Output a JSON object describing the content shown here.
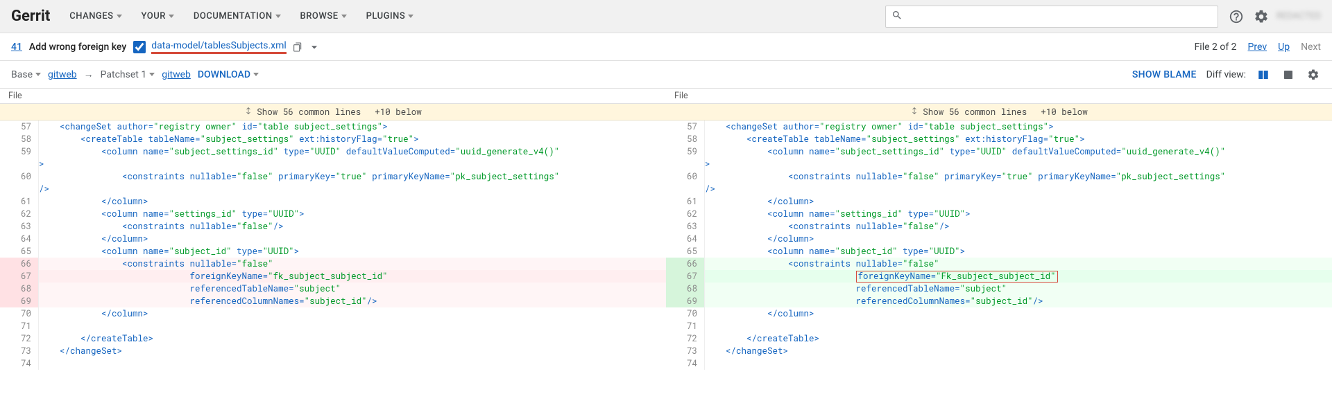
{
  "nav": {
    "brand": "Gerrit",
    "items": [
      "CHANGES",
      "YOUR",
      "DOCUMENTATION",
      "BROWSE",
      "PLUGINS"
    ],
    "search_placeholder": "",
    "user": "REDACTED"
  },
  "subheader": {
    "cl_number": "41",
    "title": "Add wrong foreign key",
    "reviewed": true,
    "filepath": "data-model/tablesSubjects.xml",
    "file_pos": "File 2 of 2",
    "prev": "Prev",
    "up": "Up",
    "next": "Next"
  },
  "patchbar": {
    "base": "Base",
    "gitweb1": "gitweb",
    "arrow": "→",
    "patchset": "Patchset 1",
    "gitweb2": "gitweb",
    "download": "DOWNLOAD",
    "show_blame": "SHOW BLAME",
    "diffview_label": "Diff view:"
  },
  "filehdr": {
    "left": "File",
    "right": "File"
  },
  "commonbanner": {
    "show_common": "Show 56 common lines",
    "below": "+10 below"
  },
  "code_left": [
    {
      "ln": 57,
      "ty": "",
      "tokens": [
        [
          "plain",
          "    "
        ],
        [
          "tag",
          "<changeSet"
        ],
        [
          "plain",
          " "
        ],
        [
          "tag",
          "author"
        ],
        [
          "punc",
          "="
        ],
        [
          "str",
          "\"registry owner\""
        ],
        [
          "plain",
          " "
        ],
        [
          "tag",
          "id"
        ],
        [
          "punc",
          "="
        ],
        [
          "str",
          "\"table subject_settings\""
        ],
        [
          "tag",
          ">"
        ]
      ]
    },
    {
      "ln": 58,
      "ty": "",
      "tokens": [
        [
          "plain",
          "        "
        ],
        [
          "tag",
          "<createTable"
        ],
        [
          "plain",
          " "
        ],
        [
          "tag",
          "tableName"
        ],
        [
          "punc",
          "="
        ],
        [
          "str",
          "\"subject_settings\""
        ],
        [
          "plain",
          " "
        ],
        [
          "tag",
          "ext:historyFlag"
        ],
        [
          "punc",
          "="
        ],
        [
          "str",
          "\"true\""
        ],
        [
          "tag",
          ">"
        ]
      ]
    },
    {
      "ln": 59,
      "ty": "",
      "tokens": [
        [
          "plain",
          "            "
        ],
        [
          "tag",
          "<column"
        ],
        [
          "plain",
          " "
        ],
        [
          "tag",
          "name"
        ],
        [
          "punc",
          "="
        ],
        [
          "str",
          "\"subject_settings_id\""
        ],
        [
          "plain",
          " "
        ],
        [
          "tag",
          "type"
        ],
        [
          "punc",
          "="
        ],
        [
          "str",
          "\"UUID\""
        ],
        [
          "plain",
          " "
        ],
        [
          "tag",
          "defaultValueComputed"
        ],
        [
          "punc",
          "="
        ],
        [
          "str",
          "\"uuid_generate_v4()\""
        ]
      ]
    },
    {
      "ln": "",
      "ty": "",
      "tokens": [
        [
          "tag",
          ">"
        ]
      ]
    },
    {
      "ln": 60,
      "ty": "",
      "tokens": [
        [
          "plain",
          "                "
        ],
        [
          "tag",
          "<constraints"
        ],
        [
          "plain",
          " "
        ],
        [
          "tag",
          "nullable"
        ],
        [
          "punc",
          "="
        ],
        [
          "str",
          "\"false\""
        ],
        [
          "plain",
          " "
        ],
        [
          "tag",
          "primaryKey"
        ],
        [
          "punc",
          "="
        ],
        [
          "str",
          "\"true\""
        ],
        [
          "plain",
          " "
        ],
        [
          "tag",
          "primaryKeyName"
        ],
        [
          "punc",
          "="
        ],
        [
          "str",
          "\"pk_subject_settings\""
        ]
      ]
    },
    {
      "ln": "",
      "ty": "",
      "tokens": [
        [
          "tag",
          "/>"
        ]
      ]
    },
    {
      "ln": 61,
      "ty": "",
      "tokens": [
        [
          "plain",
          "            "
        ],
        [
          "tag",
          "</column>"
        ]
      ]
    },
    {
      "ln": 62,
      "ty": "",
      "tokens": [
        [
          "plain",
          "            "
        ],
        [
          "tag",
          "<column"
        ],
        [
          "plain",
          " "
        ],
        [
          "tag",
          "name"
        ],
        [
          "punc",
          "="
        ],
        [
          "str",
          "\"settings_id\""
        ],
        [
          "plain",
          " "
        ],
        [
          "tag",
          "type"
        ],
        [
          "punc",
          "="
        ],
        [
          "str",
          "\"UUID\""
        ],
        [
          "tag",
          ">"
        ]
      ]
    },
    {
      "ln": 63,
      "ty": "",
      "tokens": [
        [
          "plain",
          "                "
        ],
        [
          "tag",
          "<constraints"
        ],
        [
          "plain",
          " "
        ],
        [
          "tag",
          "nullable"
        ],
        [
          "punc",
          "="
        ],
        [
          "str",
          "\"false\""
        ],
        [
          "tag",
          "/>"
        ]
      ]
    },
    {
      "ln": 64,
      "ty": "",
      "tokens": [
        [
          "plain",
          "            "
        ],
        [
          "tag",
          "</column>"
        ]
      ]
    },
    {
      "ln": 65,
      "ty": "",
      "tokens": [
        [
          "plain",
          "            "
        ],
        [
          "tag",
          "<column"
        ],
        [
          "plain",
          " "
        ],
        [
          "tag",
          "name"
        ],
        [
          "punc",
          "="
        ],
        [
          "str",
          "\"subject_id\""
        ],
        [
          "plain",
          " "
        ],
        [
          "tag",
          "type"
        ],
        [
          "punc",
          "="
        ],
        [
          "str",
          "\"UUID\""
        ],
        [
          "tag",
          ">"
        ]
      ]
    },
    {
      "ln": 66,
      "ty": "delsoft",
      "tokens": [
        [
          "plain",
          "                "
        ],
        [
          "tag",
          "<constraints"
        ],
        [
          "plain",
          " "
        ],
        [
          "tag",
          "nullable"
        ],
        [
          "punc",
          "="
        ],
        [
          "str",
          "\"false\""
        ]
      ]
    },
    {
      "ln": 67,
      "ty": "del",
      "tokens": [
        [
          "plain",
          "                             "
        ],
        [
          "tag",
          "foreignKeyName"
        ],
        [
          "punc",
          "="
        ],
        [
          "str",
          "\"fk_subject_subject_id\""
        ]
      ]
    },
    {
      "ln": 68,
      "ty": "delsoft",
      "tokens": [
        [
          "plain",
          "                             "
        ],
        [
          "tag",
          "referencedTableName"
        ],
        [
          "punc",
          "="
        ],
        [
          "str",
          "\"subject\""
        ]
      ]
    },
    {
      "ln": 69,
      "ty": "delsoft",
      "tokens": [
        [
          "plain",
          "                             "
        ],
        [
          "tag",
          "referencedColumnNames"
        ],
        [
          "punc",
          "="
        ],
        [
          "str",
          "\"subject_id\""
        ],
        [
          "tag",
          "/>"
        ]
      ]
    },
    {
      "ln": 70,
      "ty": "",
      "tokens": [
        [
          "plain",
          "            "
        ],
        [
          "tag",
          "</column>"
        ]
      ]
    },
    {
      "ln": 71,
      "ty": "",
      "tokens": [
        [
          "plain",
          ""
        ]
      ]
    },
    {
      "ln": 72,
      "ty": "",
      "tokens": [
        [
          "plain",
          "        "
        ],
        [
          "tag",
          "</createTable>"
        ]
      ]
    },
    {
      "ln": 73,
      "ty": "",
      "tokens": [
        [
          "plain",
          "    "
        ],
        [
          "tag",
          "</changeSet>"
        ]
      ]
    },
    {
      "ln": 74,
      "ty": "",
      "tokens": [
        [
          "plain",
          ""
        ]
      ]
    }
  ],
  "code_right": [
    {
      "ln": 57,
      "ty": "",
      "tokens": [
        [
          "plain",
          "    "
        ],
        [
          "tag",
          "<changeSet"
        ],
        [
          "plain",
          " "
        ],
        [
          "tag",
          "author"
        ],
        [
          "punc",
          "="
        ],
        [
          "str",
          "\"registry owner\""
        ],
        [
          "plain",
          " "
        ],
        [
          "tag",
          "id"
        ],
        [
          "punc",
          "="
        ],
        [
          "str",
          "\"table subject_settings\""
        ],
        [
          "tag",
          ">"
        ]
      ]
    },
    {
      "ln": 58,
      "ty": "",
      "tokens": [
        [
          "plain",
          "        "
        ],
        [
          "tag",
          "<createTable"
        ],
        [
          "plain",
          " "
        ],
        [
          "tag",
          "tableName"
        ],
        [
          "punc",
          "="
        ],
        [
          "str",
          "\"subject_settings\""
        ],
        [
          "plain",
          " "
        ],
        [
          "tag",
          "ext:historyFlag"
        ],
        [
          "punc",
          "="
        ],
        [
          "str",
          "\"true\""
        ],
        [
          "tag",
          ">"
        ]
      ]
    },
    {
      "ln": 59,
      "ty": "",
      "tokens": [
        [
          "plain",
          "            "
        ],
        [
          "tag",
          "<column"
        ],
        [
          "plain",
          " "
        ],
        [
          "tag",
          "name"
        ],
        [
          "punc",
          "="
        ],
        [
          "str",
          "\"subject_settings_id\""
        ],
        [
          "plain",
          " "
        ],
        [
          "tag",
          "type"
        ],
        [
          "punc",
          "="
        ],
        [
          "str",
          "\"UUID\""
        ],
        [
          "plain",
          " "
        ],
        [
          "tag",
          "defaultValueComputed"
        ],
        [
          "punc",
          "="
        ],
        [
          "str",
          "\"uuid_generate_v4()\""
        ]
      ]
    },
    {
      "ln": "",
      "ty": "",
      "tokens": [
        [
          "tag",
          ">"
        ]
      ]
    },
    {
      "ln": 60,
      "ty": "",
      "tokens": [
        [
          "plain",
          "                "
        ],
        [
          "tag",
          "<constraints"
        ],
        [
          "plain",
          " "
        ],
        [
          "tag",
          "nullable"
        ],
        [
          "punc",
          "="
        ],
        [
          "str",
          "\"false\""
        ],
        [
          "plain",
          " "
        ],
        [
          "tag",
          "primaryKey"
        ],
        [
          "punc",
          "="
        ],
        [
          "str",
          "\"true\""
        ],
        [
          "plain",
          " "
        ],
        [
          "tag",
          "primaryKeyName"
        ],
        [
          "punc",
          "="
        ],
        [
          "str",
          "\"pk_subject_settings\""
        ]
      ]
    },
    {
      "ln": "",
      "ty": "",
      "tokens": [
        [
          "tag",
          "/>"
        ]
      ]
    },
    {
      "ln": 61,
      "ty": "",
      "tokens": [
        [
          "plain",
          "            "
        ],
        [
          "tag",
          "</column>"
        ]
      ]
    },
    {
      "ln": 62,
      "ty": "",
      "tokens": [
        [
          "plain",
          "            "
        ],
        [
          "tag",
          "<column"
        ],
        [
          "plain",
          " "
        ],
        [
          "tag",
          "name"
        ],
        [
          "punc",
          "="
        ],
        [
          "str",
          "\"settings_id\""
        ],
        [
          "plain",
          " "
        ],
        [
          "tag",
          "type"
        ],
        [
          "punc",
          "="
        ],
        [
          "str",
          "\"UUID\""
        ],
        [
          "tag",
          ">"
        ]
      ]
    },
    {
      "ln": 63,
      "ty": "",
      "tokens": [
        [
          "plain",
          "                "
        ],
        [
          "tag",
          "<constraints"
        ],
        [
          "plain",
          " "
        ],
        [
          "tag",
          "nullable"
        ],
        [
          "punc",
          "="
        ],
        [
          "str",
          "\"false\""
        ],
        [
          "tag",
          "/>"
        ]
      ]
    },
    {
      "ln": 64,
      "ty": "",
      "tokens": [
        [
          "plain",
          "            "
        ],
        [
          "tag",
          "</column>"
        ]
      ]
    },
    {
      "ln": 65,
      "ty": "",
      "tokens": [
        [
          "plain",
          "            "
        ],
        [
          "tag",
          "<column"
        ],
        [
          "plain",
          " "
        ],
        [
          "tag",
          "name"
        ],
        [
          "punc",
          "="
        ],
        [
          "str",
          "\"subject_id\""
        ],
        [
          "plain",
          " "
        ],
        [
          "tag",
          "type"
        ],
        [
          "punc",
          "="
        ],
        [
          "str",
          "\"UUID\""
        ],
        [
          "tag",
          ">"
        ]
      ]
    },
    {
      "ln": 66,
      "ty": "addsoft",
      "tokens": [
        [
          "plain",
          "                "
        ],
        [
          "tag",
          "<constraints"
        ],
        [
          "plain",
          " "
        ],
        [
          "tag",
          "nullable"
        ],
        [
          "punc",
          "="
        ],
        [
          "str",
          "\"false\""
        ]
      ]
    },
    {
      "ln": 67,
      "ty": "add",
      "hl": true,
      "tokens": [
        [
          "plain",
          "                             "
        ],
        [
          "tag",
          "foreignKeyName"
        ],
        [
          "punc",
          "="
        ],
        [
          "str",
          "\"Fk_subject_subject_id\""
        ]
      ]
    },
    {
      "ln": 68,
      "ty": "addsoft",
      "tokens": [
        [
          "plain",
          "                             "
        ],
        [
          "tag",
          "referencedTableName"
        ],
        [
          "punc",
          "="
        ],
        [
          "str",
          "\"subject\""
        ]
      ]
    },
    {
      "ln": 69,
      "ty": "addsoft",
      "tokens": [
        [
          "plain",
          "                             "
        ],
        [
          "tag",
          "referencedColumnNames"
        ],
        [
          "punc",
          "="
        ],
        [
          "str",
          "\"subject_id\""
        ],
        [
          "tag",
          "/>"
        ]
      ]
    },
    {
      "ln": 70,
      "ty": "",
      "tokens": [
        [
          "plain",
          "            "
        ],
        [
          "tag",
          "</column>"
        ]
      ]
    },
    {
      "ln": 71,
      "ty": "",
      "tokens": [
        [
          "plain",
          ""
        ]
      ]
    },
    {
      "ln": 72,
      "ty": "",
      "tokens": [
        [
          "plain",
          "        "
        ],
        [
          "tag",
          "</createTable>"
        ]
      ]
    },
    {
      "ln": 73,
      "ty": "",
      "tokens": [
        [
          "plain",
          "    "
        ],
        [
          "tag",
          "</changeSet>"
        ]
      ]
    },
    {
      "ln": 74,
      "ty": "",
      "tokens": [
        [
          "plain",
          ""
        ]
      ]
    }
  ]
}
